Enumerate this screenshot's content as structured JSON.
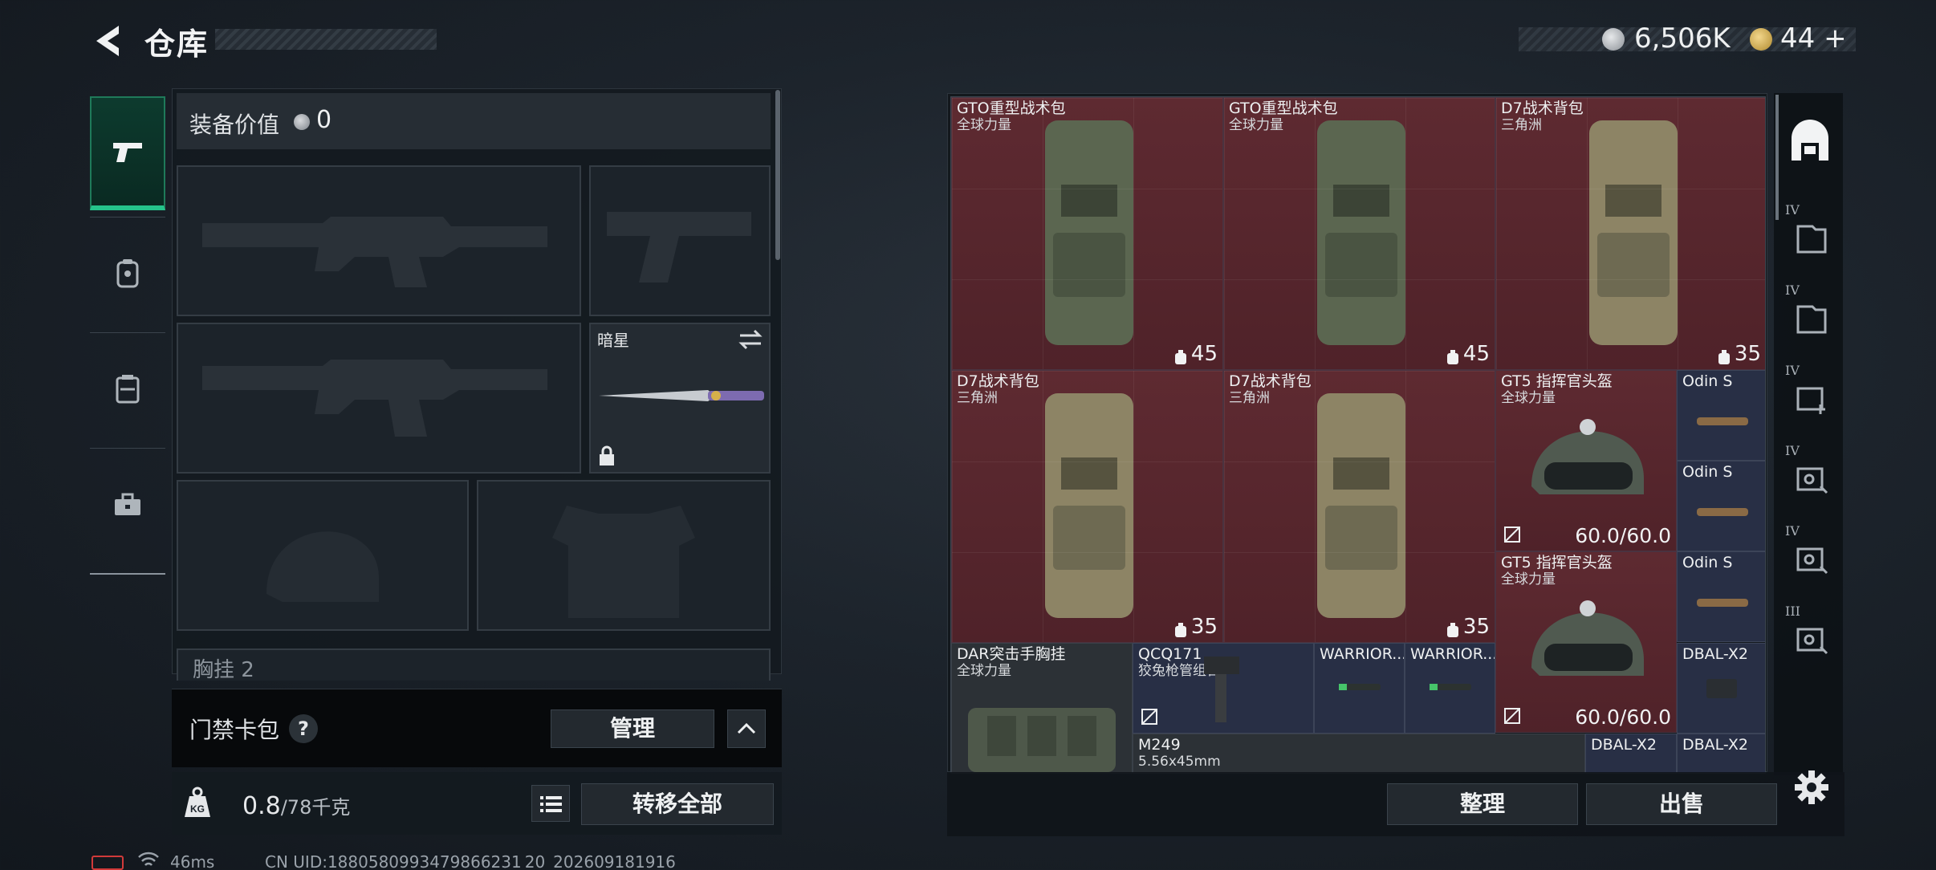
{
  "header": {
    "title": "仓库",
    "coins": "6,506K",
    "premium": "44",
    "premium_plus": "+"
  },
  "sidebar": {
    "tabs": [
      {
        "icon": "pistol-icon",
        "active": true
      },
      {
        "icon": "backpack-icon",
        "active": false
      },
      {
        "icon": "chest-rig-icon",
        "active": false
      },
      {
        "icon": "toolbox-icon",
        "active": false
      }
    ]
  },
  "equipment": {
    "value_label": "装备价值",
    "value": "0",
    "melee_name": "暗星",
    "chest_rig_label": "胸挂",
    "chest_rig_count": "2"
  },
  "access_card": {
    "label": "门禁卡包",
    "help": "?",
    "manage_label": "管理"
  },
  "weight": {
    "value": "0.8",
    "max": "/78",
    "unit": "千克",
    "transfer_all_label": "转移全部"
  },
  "status": {
    "ping": "46ms",
    "uid": "CN UID:1880580993479866231 20_202609181916"
  },
  "stash": {
    "items": [
      {
        "name": "GTO重型战术包",
        "sub": "全球力量",
        "capacity": "45"
      },
      {
        "name": "GTO重型战术包",
        "sub": "全球力量",
        "capacity": "45"
      },
      {
        "name": "D7战术背包",
        "sub": "三角洲",
        "capacity": "35"
      },
      {
        "name": "D7战术背包",
        "sub": "三角洲",
        "capacity": "35"
      },
      {
        "name": "D7战术背包",
        "sub": "三角洲",
        "capacity": "35"
      },
      {
        "name": "GT5 指挥官头盔",
        "sub": "全球力量",
        "durability": "60.0/60.0"
      },
      {
        "name": "GT5 指挥官头盔",
        "sub": "全球力量",
        "durability": "60.0/60.0"
      },
      {
        "name": "Odin S"
      },
      {
        "name": "Odin S"
      },
      {
        "name": "Odin S"
      },
      {
        "name": "DAR突击手胸挂",
        "sub": "全球力量"
      },
      {
        "name": "QCQ171",
        "sub": "狡兔枪管组合"
      },
      {
        "name": "WARRIOR..."
      },
      {
        "name": "WARRIOR..."
      },
      {
        "name": "DBAL-X2"
      },
      {
        "name": "M249",
        "sub": "5.56x45mm"
      },
      {
        "name": "DBAL-X2"
      },
      {
        "name": "DBAL-X2"
      }
    ],
    "sort_label": "整理",
    "sell_label": "出售"
  },
  "right_rail": {
    "tabs": [
      {
        "icon": "home-stash-icon"
      },
      {
        "icon": "folder-stash-icon",
        "tier": "IV"
      },
      {
        "icon": "folder-stash-icon",
        "tier": "IV"
      },
      {
        "icon": "medical-stash-icon",
        "tier": "IV"
      },
      {
        "icon": "key-stash-icon",
        "tier": "IV"
      },
      {
        "icon": "key-stash-icon",
        "tier": "IV"
      },
      {
        "icon": "key-stash-icon",
        "tier": "III"
      }
    ]
  },
  "colors": {
    "active_tab": "#25c38b",
    "item_red": "#5e2a31",
    "item_blue": "#282f45"
  }
}
